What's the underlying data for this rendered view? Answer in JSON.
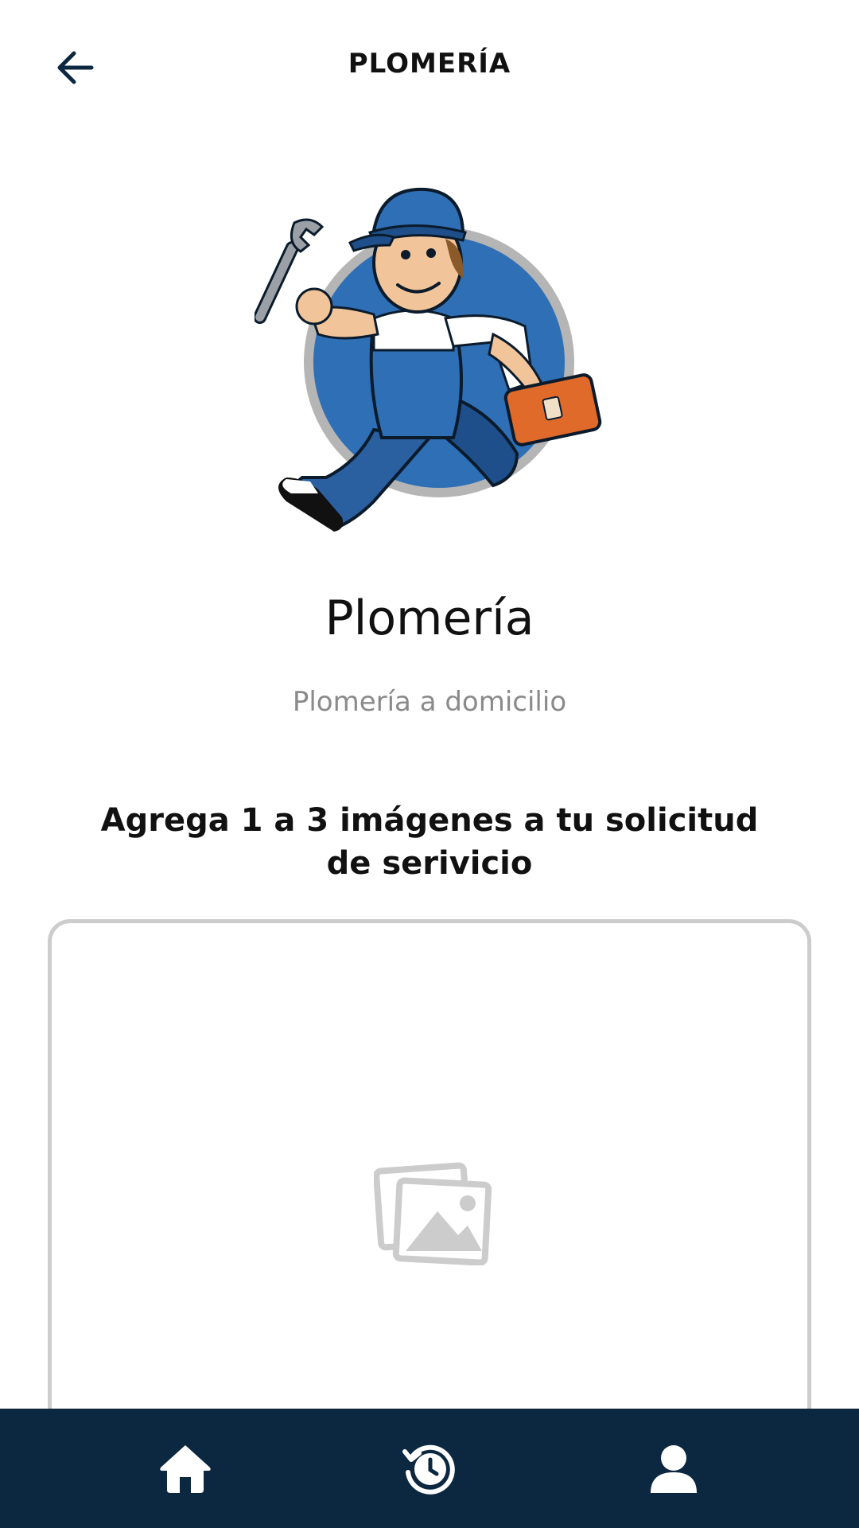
{
  "header": {
    "title": "PLOMERÍA",
    "back_icon": "arrow-left-icon"
  },
  "service": {
    "illustration": "plumber-mascot",
    "title": "Plomería",
    "subtitle": "Plomería a domicilio"
  },
  "upload": {
    "instructions": "Agrega 1 a 3 imágenes a tu solicitud de serivicio",
    "icon": "image-gallery-icon"
  },
  "bottom_nav": {
    "items": [
      {
        "icon": "home-icon"
      },
      {
        "icon": "history-icon"
      },
      {
        "icon": "profile-icon"
      }
    ]
  },
  "colors": {
    "nav_background": "#0c2740",
    "accent_blue": "#2e6fb5",
    "placeholder_gray": "#cccccc"
  }
}
